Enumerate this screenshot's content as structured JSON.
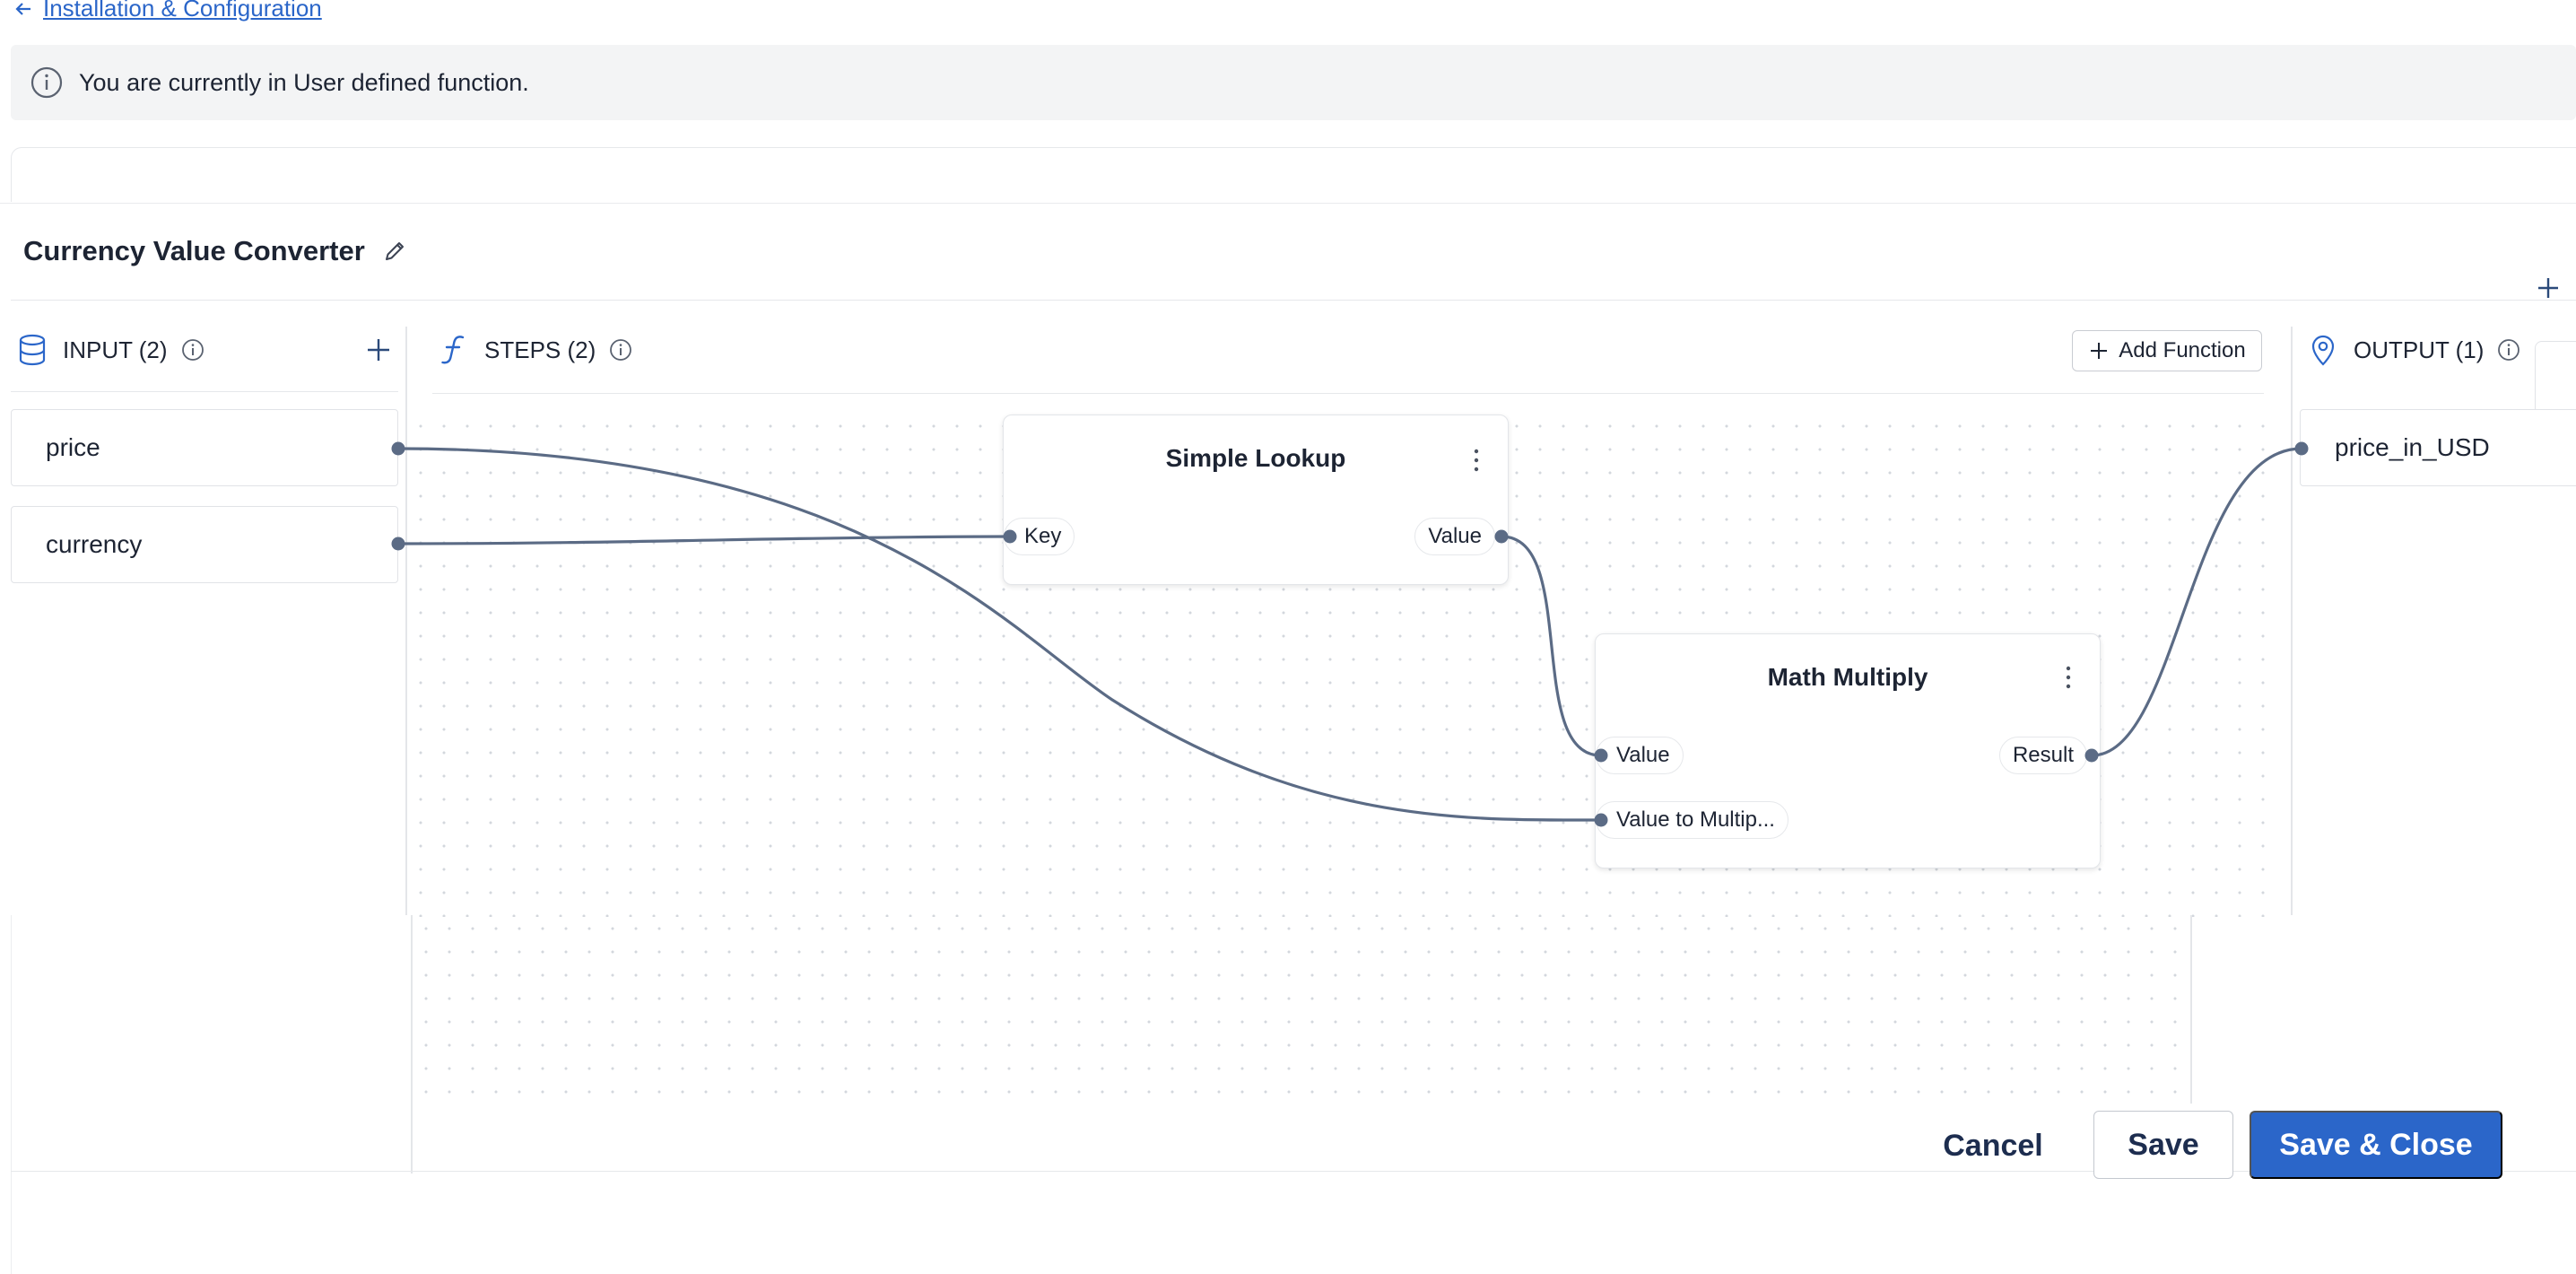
{
  "nav": {
    "back_label": "Installation & Configuration"
  },
  "banner": {
    "text": "You are currently in User defined function."
  },
  "function_title": "Currency Value Converter",
  "input_column": {
    "header": "INPUT (2)",
    "items": [
      {
        "label": "price"
      },
      {
        "label": "currency"
      }
    ]
  },
  "steps_column": {
    "header": "STEPS (2)",
    "add_function_label": "Add Function",
    "nodes": [
      {
        "title": "Simple Lookup",
        "inputs": [
          "Key"
        ],
        "outputs": [
          "Value"
        ]
      },
      {
        "title": "Math Multiply",
        "inputs": [
          "Value",
          "Value to Multip..."
        ],
        "outputs": [
          "Result"
        ]
      }
    ]
  },
  "output_column": {
    "header": "OUTPUT (1)",
    "items": [
      {
        "label": "price_in_USD"
      }
    ]
  },
  "footer": {
    "cancel_label": "Cancel",
    "save_label": "Save",
    "save_close_label": "Save & Close"
  },
  "colors": {
    "accent": "#2b66c9",
    "wire": "#5b6b85",
    "banner_bg": "#f3f4f5"
  },
  "icons": [
    "arrow-left-icon",
    "info-icon",
    "pencil-icon",
    "database-icon",
    "function-icon",
    "location-pin-icon",
    "plus-icon",
    "kebab-menu-icon"
  ]
}
